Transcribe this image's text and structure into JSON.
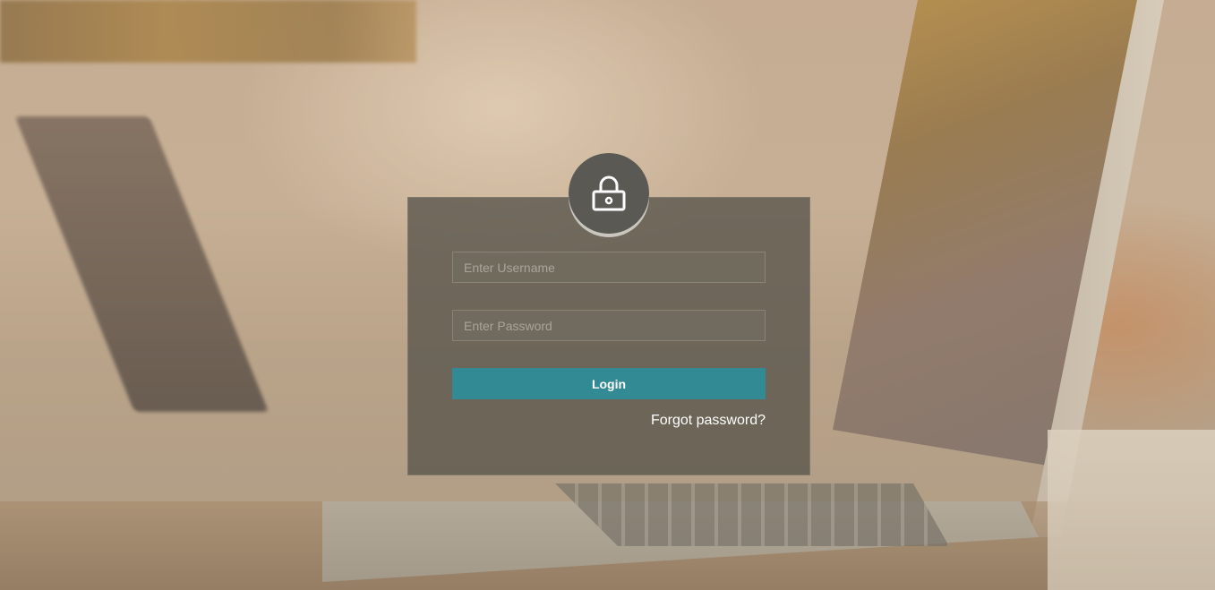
{
  "login_form": {
    "username_placeholder": "Enter Username",
    "username_value": "",
    "password_placeholder": "Enter Password",
    "password_value": "",
    "login_button_label": "Login",
    "forgot_password_label": "Forgot password?"
  },
  "icons": {
    "lock": "lock-icon"
  },
  "colors": {
    "accent": "#328a95",
    "card_background": "#5c584e",
    "lock_badge": "#5b5954"
  }
}
